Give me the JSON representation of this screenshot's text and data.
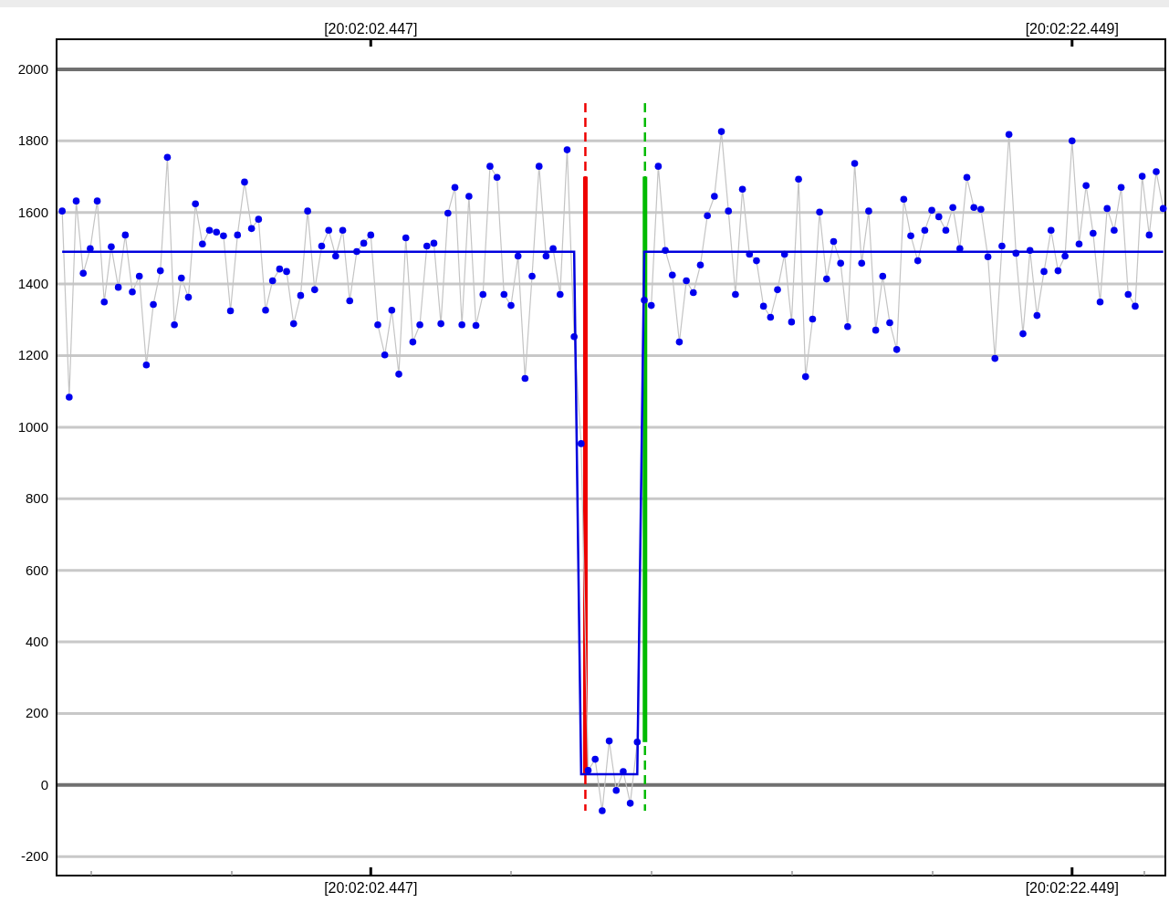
{
  "chart": {
    "top_labels": [
      "[20:02:02.447]",
      "[20:02:22.449]"
    ],
    "markers": [
      {
        "color": "#ee0000"
      },
      {
        "color": "#00bb00"
      }
    ],
    "chart_data": {
      "type": "line",
      "grid": true,
      "ylim": [
        -253,
        2084
      ],
      "yticks": [
        -200,
        0,
        200,
        400,
        600,
        800,
        1000,
        1200,
        1400,
        1600,
        1800,
        2000
      ],
      "categories": [
        null,
        null,
        null,
        null,
        null,
        null,
        null,
        null,
        null,
        null,
        null,
        null,
        null,
        null,
        null,
        null,
        null,
        null,
        null,
        null,
        null,
        null,
        null,
        null,
        null,
        null,
        null,
        null,
        null,
        null,
        null,
        null,
        null,
        null,
        null,
        null,
        null,
        null,
        null,
        null,
        null,
        null,
        null,
        null,
        "[20:02:02.447]",
        null,
        null,
        null,
        null,
        null,
        null,
        null,
        null,
        null,
        null,
        null,
        null,
        null,
        null,
        null,
        null,
        null,
        null,
        null,
        null,
        null,
        null,
        null,
        null,
        null,
        null,
        null,
        null,
        null,
        null,
        null,
        null,
        null,
        null,
        null,
        null,
        null,
        null,
        null,
        null,
        null,
        null,
        null,
        null,
        null,
        null,
        null,
        null,
        null,
        null,
        null,
        null,
        null,
        null,
        null,
        null,
        null,
        null,
        null,
        null,
        null,
        null,
        null,
        null,
        null,
        null,
        null,
        null,
        null,
        null,
        null,
        null,
        null,
        null,
        null,
        null,
        null,
        null,
        null,
        null,
        null,
        null,
        null,
        null,
        null,
        null,
        null,
        null,
        null,
        null,
        null,
        null,
        null,
        null,
        null,
        null,
        null,
        null,
        null,
        "[20:02:22.449]",
        null,
        null,
        null,
        null,
        null,
        null,
        null,
        null,
        null,
        null,
        null,
        null,
        null
      ],
      "series": [
        {
          "color": "#0000ee",
          "marker": "circle",
          "values": [
            1604,
            1084,
            1632,
            1430,
            1499,
            1632,
            1350,
            1504,
            1391,
            1537,
            1378,
            1422,
            1174,
            1343,
            1437,
            1754,
            1286,
            1417,
            1363,
            1624,
            1512,
            1550,
            1545,
            1535,
            1325,
            1537,
            1685,
            1555,
            1581,
            1327,
            1409,
            1442,
            1435,
            1289,
            1368,
            1604,
            1384,
            1506,
            1550,
            1478,
            1550,
            1353,
            1491,
            1514,
            1537,
            1286,
            1202,
            1327,
            1148,
            1529,
            1238,
            1286,
            1506,
            1514,
            1289,
            1598,
            1670,
            1286,
            1645,
            1284,
            1371,
            1729,
            1698,
            1371,
            1340,
            1478,
            1136,
            1422,
            1729,
            1478,
            1499,
            1371,
            1775,
            1253,
            954,
            41,
            72,
            -72,
            123,
            -15,
            38,
            -51,
            120,
            1355,
            1340,
            1729,
            1494,
            1425,
            1238,
            1409,
            1376,
            1453,
            1591,
            1645,
            1826,
            1604,
            1371,
            1665,
            1483,
            1465,
            1338,
            1307,
            1384,
            1483,
            1294,
            1693,
            1141,
            1302,
            1601,
            1414,
            1519,
            1458,
            1281,
            1737,
            1458,
            1604,
            1271,
            1422,
            1292,
            1217,
            1637,
            1535,
            1465,
            1550,
            1606,
            1588,
            1550,
            1614,
            1499,
            1698,
            1614,
            1609,
            1476,
            1192,
            1506,
            1818,
            1486,
            1261,
            1494,
            1312,
            1435,
            1550,
            1437,
            1478,
            1800,
            1512,
            1675,
            1542,
            1350,
            1611,
            1550,
            1670,
            1371,
            1338,
            1701,
            1537,
            1714,
            1611
          ]
        },
        {
          "color": "#0000dd",
          "values": [
            1490,
            1490,
            1490,
            1490,
            1490,
            1490,
            1490,
            1490,
            1490,
            1490,
            1490,
            1490,
            1490,
            1490,
            1490,
            1490,
            1490,
            1490,
            1490,
            1490,
            1490,
            1490,
            1490,
            1490,
            1490,
            1490,
            1490,
            1490,
            1490,
            1490,
            1490,
            1490,
            1490,
            1490,
            1490,
            1490,
            1490,
            1490,
            1490,
            1490,
            1490,
            1490,
            1490,
            1490,
            1490,
            1490,
            1490,
            1490,
            1490,
            1490,
            1490,
            1490,
            1490,
            1490,
            1490,
            1490,
            1490,
            1490,
            1490,
            1490,
            1490,
            1490,
            1490,
            1490,
            1490,
            1490,
            1490,
            1490,
            1490,
            1490,
            1490,
            1490,
            1490,
            1490,
            30,
            30,
            30,
            30,
            30,
            30,
            30,
            30,
            30,
            1490,
            1490,
            1490,
            1490,
            1490,
            1490,
            1490,
            1490,
            1490,
            1490,
            1490,
            1490,
            1490,
            1490,
            1490,
            1490,
            1490,
            1490,
            1490,
            1490,
            1490,
            1490,
            1490,
            1490,
            1490,
            1490,
            1490,
            1490,
            1490,
            1490,
            1490,
            1490,
            1490,
            1490,
            1490,
            1490,
            1490,
            1490,
            1490,
            1490,
            1490,
            1490,
            1490,
            1490,
            1490,
            1490,
            1490,
            1490,
            1490,
            1490,
            1490,
            1490,
            1490,
            1490,
            1490,
            1490,
            1490,
            1490,
            1490,
            1490,
            1490,
            1490,
            1490,
            1490,
            1490,
            1490,
            1490,
            1490,
            1490,
            1490,
            1490,
            1490,
            1490,
            1490,
            1490
          ]
        }
      ]
    }
  }
}
